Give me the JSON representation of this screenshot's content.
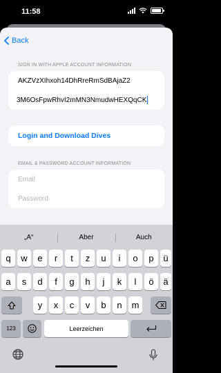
{
  "status": {
    "time": "11:58"
  },
  "nav": {
    "back_label": "Back"
  },
  "apple_section": {
    "header": "SIGN IN WITH APPLE ACCOUNT INFORMATION",
    "field1_value": "AKZVzXIhxoh14DhRreRmSdBAjaZ2",
    "field2_value": "3M6OsFpwRhvI2mMN3NmudwHEXQqCK"
  },
  "login_button": {
    "label": "Login and Download Dives"
  },
  "email_section": {
    "header": "EMAIL & PASSWORD ACCOUNT INFORMATION",
    "email_placeholder": "Email",
    "password_placeholder": "Password"
  },
  "keyboard": {
    "suggestions": [
      "„A“",
      "Aber",
      "Auch"
    ],
    "row1": [
      "q",
      "w",
      "e",
      "r",
      "t",
      "z",
      "u",
      "i",
      "o",
      "p",
      "ü"
    ],
    "row2": [
      "a",
      "s",
      "d",
      "f",
      "g",
      "h",
      "j",
      "k",
      "l",
      "ö",
      "ä"
    ],
    "row3": [
      "y",
      "x",
      "c",
      "v",
      "b",
      "n",
      "m"
    ],
    "numbers_key": "123",
    "space_label": "Leerzeichen"
  }
}
